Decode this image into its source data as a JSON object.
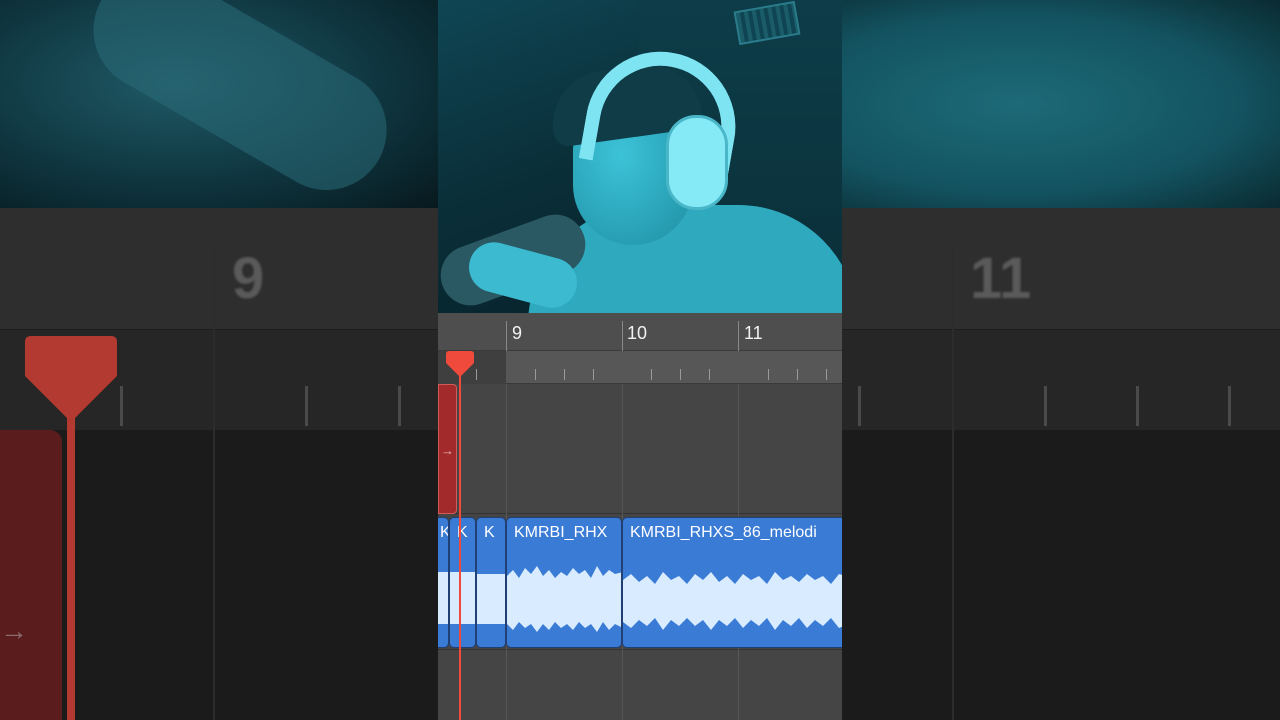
{
  "background": {
    "left_bar_number": "9",
    "right_bar_number": "11"
  },
  "timeline": {
    "bar_numbers": [
      "9",
      "10",
      "11"
    ]
  },
  "regions": [
    {
      "name": "K"
    },
    {
      "name": "K"
    },
    {
      "name": "K"
    },
    {
      "name": "KMRBI_RHX"
    },
    {
      "name": "KMRBI_RHXS_86_melodi"
    }
  ],
  "colors": {
    "playhead": "#ef4a3c",
    "audio_region": "#3a7bd5",
    "waveform": "#d9ecff",
    "midi_region": "#a22a2a"
  },
  "icons": {
    "midi_region_marker": "arrow-right-icon",
    "playhead": "playhead-marker-icon"
  }
}
